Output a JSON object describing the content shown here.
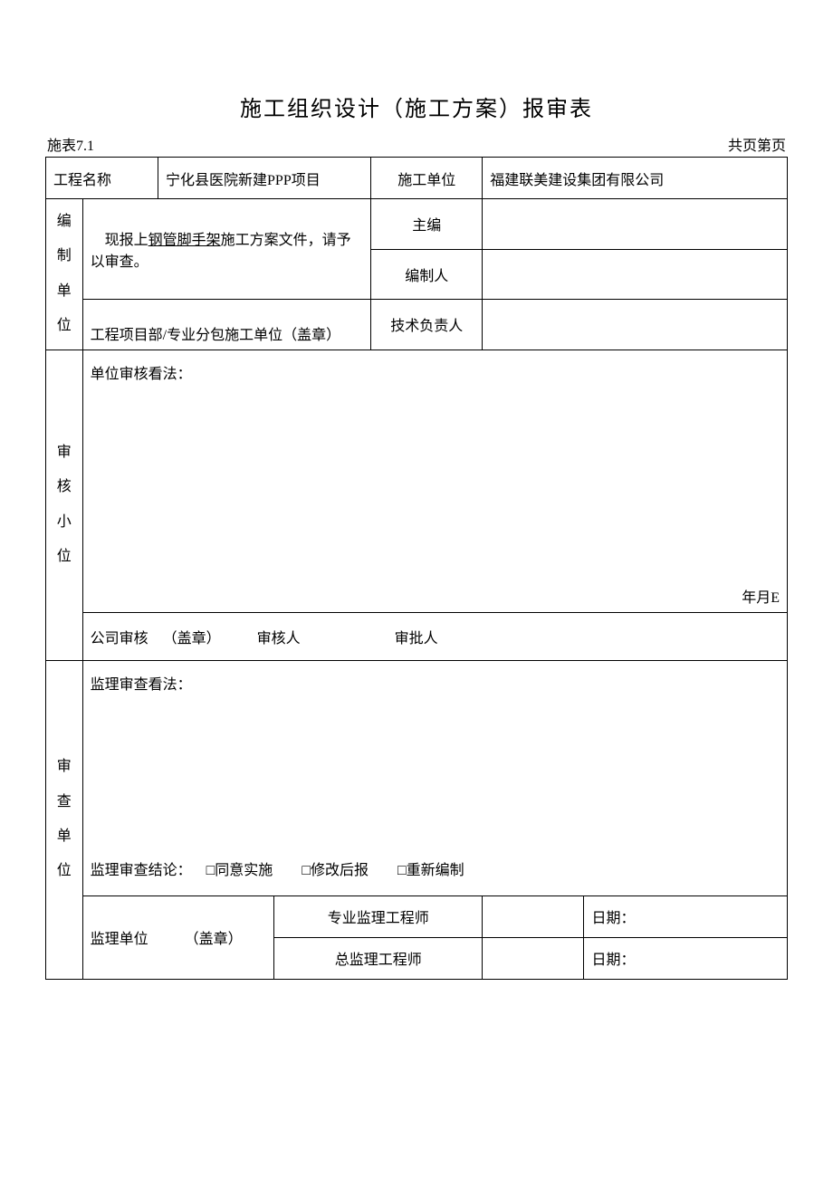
{
  "title": "施工组织设计（施工方案）报审表",
  "meta": {
    "form_number": "施表7.1",
    "page_info": "共页第页"
  },
  "header": {
    "project_name_label": "工程名称",
    "project_name_value": "宁化县医院新建PPP项目",
    "construction_unit_label": "施工单位",
    "construction_unit_value": "福建联美建设集团有限公司"
  },
  "submit": {
    "vlabel": "编制单位",
    "submit_text_prefix": "现报上",
    "submit_text_underlined": "钢管脚手架",
    "submit_text_suffix": "施工方案文件，请予以审查。",
    "chief_editor_label": "主编",
    "chief_editor_value": "",
    "compiler_label": "编制人",
    "compiler_value": "",
    "tech_lead_label": "技术负责人",
    "tech_lead_value": "",
    "seal_line": "工程项目部/专业分包施工单位（盖章）"
  },
  "review": {
    "vlabel_chars": [
      "审",
      "核",
      "小",
      "位"
    ],
    "opinion_label": "单位审核看法：",
    "date_text": "年月E",
    "company_seal_label": "公司审核",
    "seal_text": "（盖章）",
    "reviewer_label": "审核人",
    "approver_label": "审批人"
  },
  "inspect": {
    "vlabel_chars": [
      "审",
      "查",
      "单",
      "位"
    ],
    "opinion_label": "监理审查看法：",
    "conclusion_label": "监理审查结论：",
    "opt1": "□同意实施",
    "opt2": "□修改后报",
    "opt3": "□重新编制",
    "unit_label": "监理单位",
    "seal_text": "（盖章）",
    "pro_engineer_label": "专业监理工程师",
    "pro_engineer_value": "",
    "chief_engineer_label": "总监理工程师",
    "chief_engineer_value": "",
    "date_label": "日期："
  }
}
